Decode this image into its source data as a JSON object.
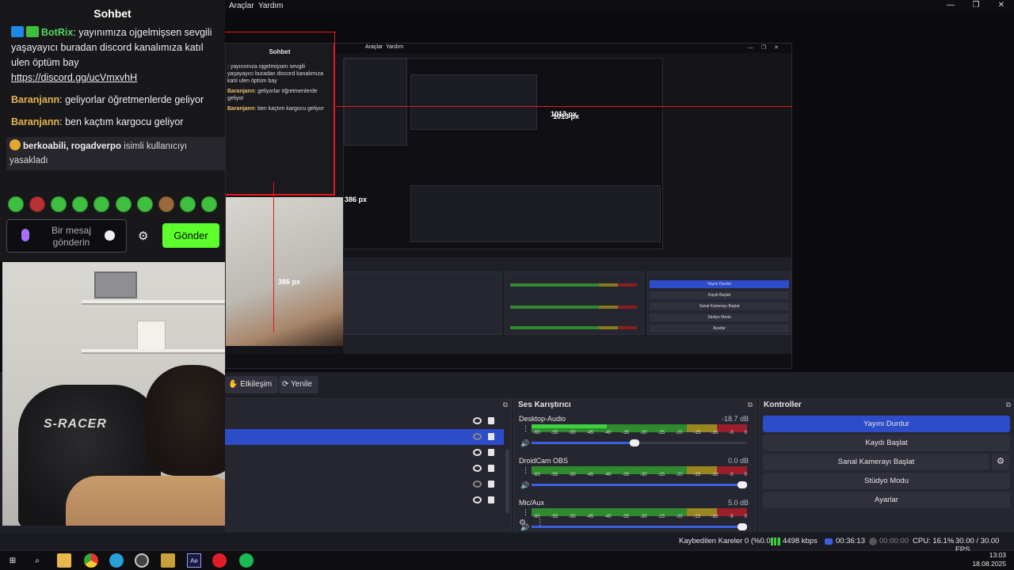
{
  "menubar": {
    "items": [
      "Araçlar",
      "Yardım"
    ]
  },
  "window_controls": {
    "minimize": "—",
    "restore": "❐",
    "close": "✕"
  },
  "chat": {
    "title": "Sohbet",
    "messages": [
      {
        "user": "BotRix",
        "text": ": yayınımıza ojgelmişsen sevgili yaşayayıcı buradan discord kanalımıza katıl ulen öptüm bay",
        "link": "https://discord.gg/ucVmxvhH"
      },
      {
        "user": "Baranjann",
        "text": ": geliyorlar öğretmenlerde geliyor"
      },
      {
        "user": "Baranjann",
        "text": ": ben kaçtım kargocu geliyor"
      }
    ],
    "mod_notice": {
      "names": "berkoabili, rogadverpo",
      "text": "isimli kullanıcıyı yasakladı"
    },
    "input_placeholder": "Bir mesaj gönderin",
    "send_label": "Gönder"
  },
  "nested_preview": {
    "chat_title": "Sohbet",
    "menu_items": [
      "Araçlar",
      "Yardım"
    ],
    "label_wide": "1013 px",
    "label_tall": "386 px",
    "label_inner": "1013 px",
    "label_inner_tall": "386 px"
  },
  "toolbar": {
    "interact_label": "Etkileşim",
    "refresh_label": "Yenile"
  },
  "sources": {
    "rows": [
      {
        "visible": true,
        "selected": false
      },
      {
        "visible": false,
        "selected": true
      },
      {
        "visible": true,
        "selected": false
      },
      {
        "visible": true,
        "selected": false
      },
      {
        "visible": false,
        "selected": false
      },
      {
        "visible": true,
        "selected": false
      }
    ]
  },
  "mixer": {
    "title": "Ses Karıştırıcı",
    "scale": [
      "-60",
      "-55",
      "-50",
      "-45",
      "-40",
      "-35",
      "-30",
      "-25",
      "-20",
      "-15",
      "-10",
      "-5",
      "0"
    ],
    "channels": [
      {
        "name": "Desktop-Audio",
        "db": "-18.7 dB",
        "volume": 0.5,
        "level": 0.35
      },
      {
        "name": "DroidCam OBS",
        "db": "0.0 dB",
        "volume": 1.0,
        "level": 0.0
      },
      {
        "name": "Mic/Aux",
        "db": "5.0 dB",
        "volume": 1.0,
        "level": 0.0
      }
    ]
  },
  "controls": {
    "title": "Kontroller",
    "buttons": [
      "Yayını Durdur",
      "Kaydı Başlat",
      "Sanal Kamerayı Başlat",
      "Stüdyo Modu",
      "Ayarlar"
    ]
  },
  "status": {
    "dropped": "Kaybedilen Kareler 0 (%0.0)",
    "bitrate": "4498 kbps",
    "live_time": "00:36:13",
    "rec_time": "00:00:00",
    "cpu": "CPU: 16.1%",
    "fps": "30.00 / 30.00 FPS"
  },
  "taskbar": {
    "time": "13:03",
    "date": "18.08.2025",
    "icons": [
      "windows-start",
      "search",
      "file-explorer",
      "chrome",
      "telegram",
      "obs",
      "winrar",
      "after-effects",
      "opera",
      "spotify"
    ]
  },
  "colors": {
    "accent": "#2d4cc8",
    "twitch_green": "#5cff2b",
    "meter_green": "#2f8a2f",
    "highlight_red": "#e31b1b"
  }
}
